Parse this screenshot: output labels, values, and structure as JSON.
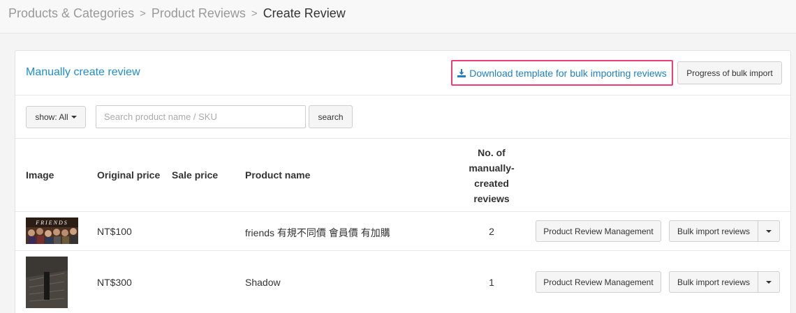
{
  "breadcrumb": {
    "items": [
      "Products & Categories",
      "Product Reviews"
    ],
    "current": "Create Review",
    "separator": ">"
  },
  "panel": {
    "title": "Manually create review",
    "download_label": "Download template for bulk importing reviews",
    "progress_label": "Progress of bulk import"
  },
  "filters": {
    "show_label": "show: All",
    "search_placeholder": "Search product name / SKU",
    "search_button": "search"
  },
  "table": {
    "headers": {
      "image": "Image",
      "original_price": "Original price",
      "sale_price": "Sale price",
      "product_name": "Product name",
      "count": "No. of manually-created reviews"
    },
    "rows": [
      {
        "image": "friends-thumbnail",
        "image_text": "FRIENDS",
        "original_price": "NT$100",
        "sale_price": "",
        "product_name": "friends 有規不同價 會員價 有加購",
        "count": "2",
        "manage_label": "Product Review Management",
        "bulk_label": "Bulk import reviews"
      },
      {
        "image": "shadow-thumbnail",
        "original_price": "NT$300",
        "sale_price": "",
        "product_name": "Shadow",
        "count": "1",
        "manage_label": "Product Review Management",
        "bulk_label": "Bulk import reviews"
      }
    ]
  },
  "colors": {
    "link": "#1f8ecf",
    "highlight_border": "#f13d74"
  }
}
